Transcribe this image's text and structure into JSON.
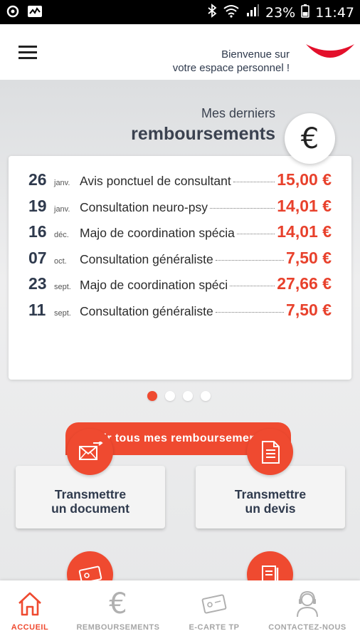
{
  "status_bar": {
    "battery": "23%",
    "time": "11:47",
    "icons": [
      "sync-icon",
      "activity-icon",
      "bluetooth-icon",
      "wifi-icon",
      "signal-icon",
      "battery-icon"
    ]
  },
  "header": {
    "welcome_line1": "Bienvenue sur",
    "welcome_line2": "votre espace personnel !",
    "menu_icon": "hamburger-icon",
    "accent": "#ef4a30"
  },
  "remboursements": {
    "title_line1": "Mes derniers",
    "title_line2": "remboursements",
    "badge_symbol": "€",
    "items": [
      {
        "day": "26",
        "month": "janv.",
        "label": "Avis ponctuel de consultant",
        "amount": "15,00 €"
      },
      {
        "day": "19",
        "month": "janv.",
        "label": "Consultation neuro-psy",
        "amount": "14,01 €"
      },
      {
        "day": "16",
        "month": "déc.",
        "label": "Majo de coordination spécia",
        "amount": "14,01 €"
      },
      {
        "day": "07",
        "month": "oct.",
        "label": "Consultation généraliste",
        "amount": "7,50 €"
      },
      {
        "day": "23",
        "month": "sept.",
        "label": "Majo de coordination spéci",
        "amount": "27,66 €"
      },
      {
        "day": "11",
        "month": "sept.",
        "label": "Consultation généraliste",
        "amount": "7,50 €"
      }
    ],
    "see_all_label": "Voir tous mes remboursements",
    "pager_count": 4,
    "pager_active": 0
  },
  "tiles": [
    {
      "line1": "Transmettre",
      "line2": "un document",
      "icon": "envelope-send-icon"
    },
    {
      "line1": "Transmettre",
      "line2": "un devis",
      "icon": "document-icon"
    },
    {
      "line1": "",
      "line2": "",
      "icon": "card-icon"
    },
    {
      "line1": "",
      "line2": "",
      "icon": "form-icon"
    }
  ],
  "bottom_nav": [
    {
      "label": "ACCUEIL",
      "icon": "home-icon",
      "active": true
    },
    {
      "label": "REMBOURSEMENTS",
      "icon": "euro-icon",
      "active": false
    },
    {
      "label": "E-CARTE TP",
      "icon": "card-icon",
      "active": false
    },
    {
      "label": "CONTACTEZ-NOUS",
      "icon": "support-agent-icon",
      "active": false
    }
  ]
}
